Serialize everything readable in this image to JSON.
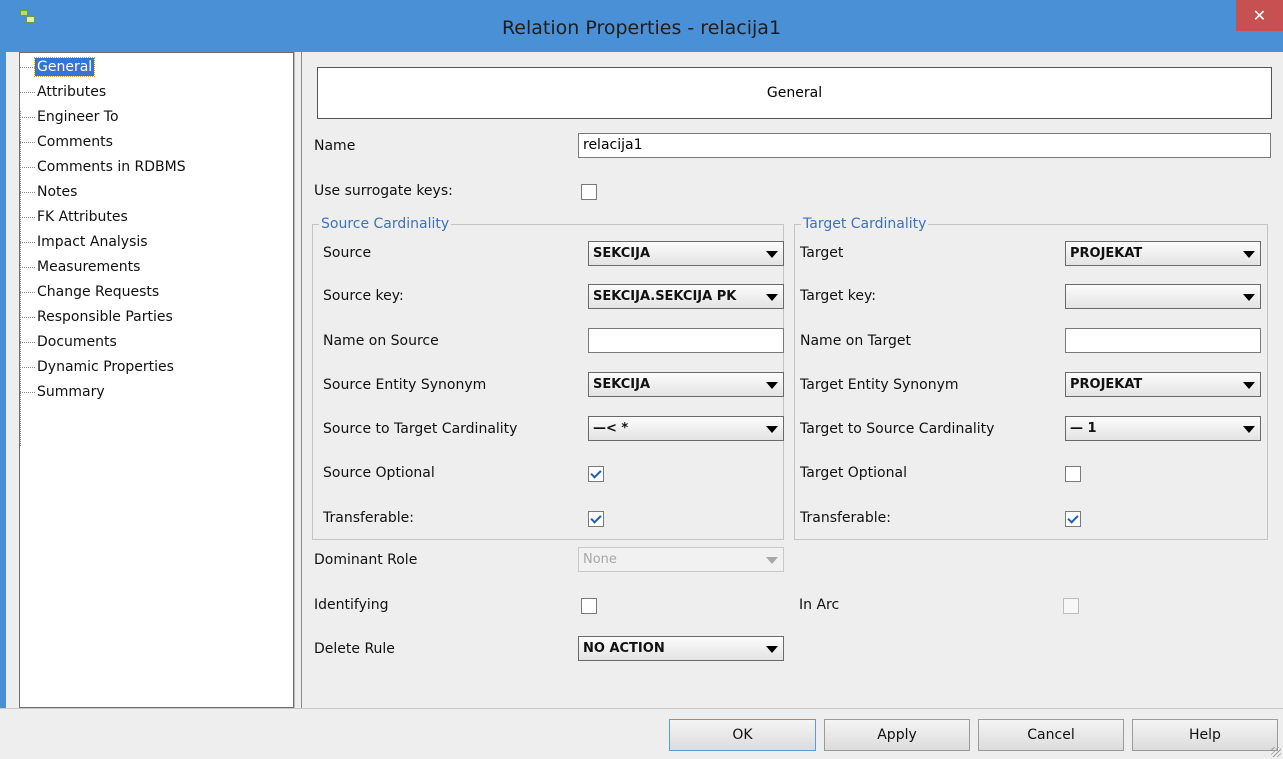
{
  "window": {
    "title": "Relation Properties - relacija1",
    "close_label": "✕"
  },
  "tree": {
    "items": [
      {
        "label": "General",
        "selected": true
      },
      {
        "label": "Attributes"
      },
      {
        "label": "Engineer To"
      },
      {
        "label": "Comments"
      },
      {
        "label": "Comments in RDBMS"
      },
      {
        "label": "Notes"
      },
      {
        "label": "FK Attributes"
      },
      {
        "label": "Impact Analysis"
      },
      {
        "label": "Measurements"
      },
      {
        "label": "Change Requests"
      },
      {
        "label": "Responsible Parties"
      },
      {
        "label": "Documents"
      },
      {
        "label": "Dynamic Properties"
      },
      {
        "label": "Summary"
      }
    ]
  },
  "panel": {
    "header": "General",
    "name_label": "Name",
    "name_value": "relacija1",
    "surrogate_label": "Use surrogate keys:",
    "surrogate_checked": false,
    "source": {
      "group_title": "Source Cardinality",
      "source_label": "Source",
      "source_value": "SEKCIJA",
      "key_label": "Source key:",
      "key_value": "SEKCIJA.SEKCIJA PK",
      "name_label": "Name on Source",
      "name_value": "",
      "synonym_label": "Source Entity Synonym",
      "synonym_value": "SEKCIJA",
      "cardinality_label": "Source to Target Cardinality",
      "cardinality_value": "—< *",
      "optional_label": "Source Optional",
      "optional_checked": true,
      "transferable_label": "Transferable:",
      "transferable_checked": true
    },
    "target": {
      "group_title": "Target Cardinality",
      "target_label": "Target",
      "target_value": "PROJEKAT",
      "key_label": "Target key:",
      "key_value": "",
      "name_label": "Name on Target",
      "name_value": "",
      "synonym_label": "Target Entity Synonym",
      "synonym_value": "PROJEKAT",
      "cardinality_label": "Target to Source Cardinality",
      "cardinality_value": "— 1",
      "optional_label": "Target Optional",
      "optional_checked": false,
      "transferable_label": "Transferable:",
      "transferable_checked": true
    },
    "dominant_label": "Dominant Role",
    "dominant_value": "None",
    "identifying_label": "Identifying",
    "identifying_checked": false,
    "inarc_label": "In Arc",
    "inarc_checked": false,
    "delete_rule_label": "Delete Rule",
    "delete_rule_value": "NO ACTION"
  },
  "buttons": {
    "ok": "OK",
    "apply": "Apply",
    "cancel": "Cancel",
    "help": "Help"
  },
  "colors": {
    "titlebar": "#4a90d6",
    "close": "#c75050",
    "selection": "#3375d6",
    "group_title": "#3b73b9"
  },
  "icons": {
    "app": "relation-model-icon",
    "close": "close-icon",
    "dropdown": "chevron-down-icon"
  }
}
